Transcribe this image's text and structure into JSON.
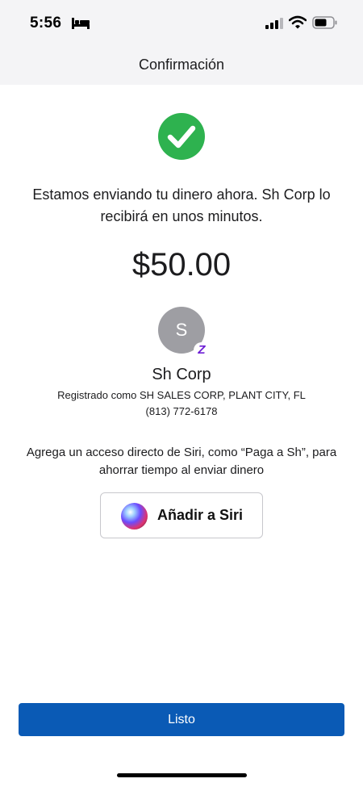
{
  "status_bar": {
    "time": "5:56",
    "icons": [
      "bed-icon",
      "signal-icon",
      "wifi-icon",
      "battery-icon"
    ]
  },
  "nav": {
    "title": "Confirmación"
  },
  "confirmation": {
    "icon": "check-icon",
    "accent_color": "#2eb24f",
    "message": "Estamos enviando tu dinero ahora. Sh Corp lo recibirá en unos minutos.",
    "amount": "$50.00"
  },
  "recipient": {
    "initial": "S",
    "badge_icon": "zelle-icon",
    "badge_letter": "Z",
    "name": "Sh Corp",
    "registered": "Registrado como SH SALES CORP, PLANT CITY, FL",
    "phone": "(813) 772-6178"
  },
  "siri": {
    "prompt": "Agrega un acceso directo de Siri, como “Paga a Sh”, para ahorrar tiempo al enviar dinero",
    "button_label": "Añadir a Siri"
  },
  "footer": {
    "done_label": "Listo",
    "button_color": "#0a5ab5"
  }
}
